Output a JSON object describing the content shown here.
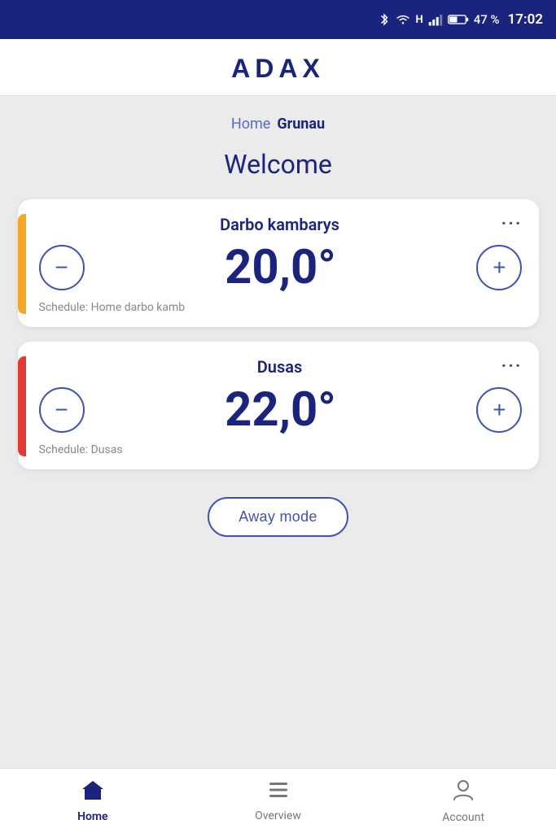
{
  "statusBar": {
    "battery": "47 %",
    "time": "17:02"
  },
  "header": {
    "logo": "ADAX"
  },
  "breadcrumb": {
    "home": "Home",
    "current": "Grunau"
  },
  "welcome": "Welcome",
  "cards": [
    {
      "name": "Darbo kambarys",
      "temperature": "20,0°",
      "schedule": "Schedule: Home darbo kamb",
      "indicator": "yellow"
    },
    {
      "name": "Dusas",
      "temperature": "22,0°",
      "schedule": "Schedule: Dusas",
      "indicator": "orange"
    }
  ],
  "awayModeButton": "Away mode",
  "bottomNav": [
    {
      "label": "Home",
      "id": "home",
      "active": true
    },
    {
      "label": "Overview",
      "id": "overview",
      "active": false
    },
    {
      "label": "Account",
      "id": "account",
      "active": false
    }
  ]
}
